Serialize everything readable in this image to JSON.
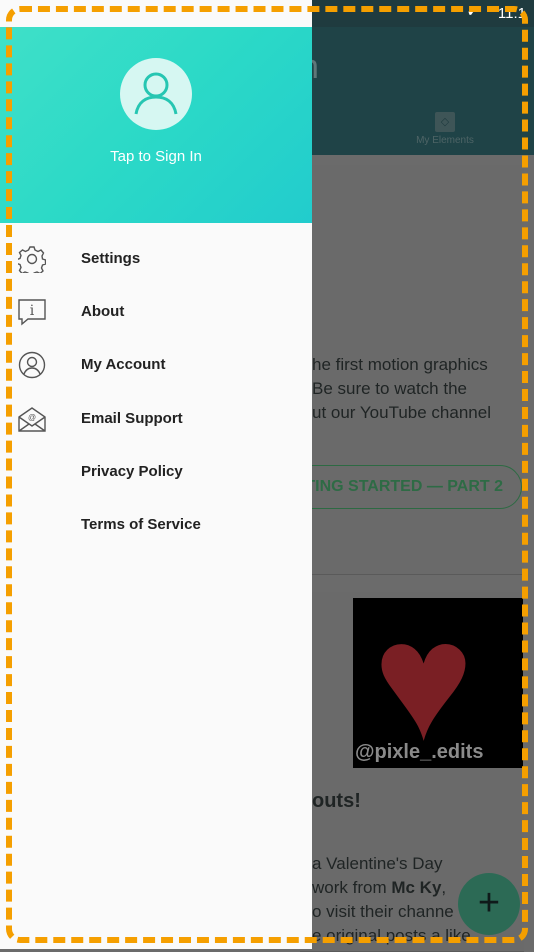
{
  "status_bar": {
    "time": "11:1"
  },
  "background": {
    "logo_fragment": "n",
    "tab_my_elements": "My Elements",
    "card1_text": [
      "he first motion graphics",
      "Be sure to watch the",
      "ut our YouTube channel"
    ],
    "card1_button": "ETTING STARTED — PART 2",
    "card2_image_tag": "@pixle_.edits",
    "card2_title": "outs!",
    "card2_text": [
      "a Valentine's Day",
      "work from ",
      "o visit their channe",
      "e original posts a like"
    ],
    "card2_author": "Mc Ky",
    "fab_label": "+"
  },
  "drawer": {
    "sign_in": "Tap to Sign In",
    "items": [
      {
        "label": "Settings",
        "icon": "gear-icon"
      },
      {
        "label": "About",
        "icon": "info-bubble-icon"
      },
      {
        "label": "My Account",
        "icon": "account-icon"
      },
      {
        "label": "Email Support",
        "icon": "email-icon"
      },
      {
        "label": "Privacy Policy",
        "icon": ""
      },
      {
        "label": "Terms of Service",
        "icon": ""
      }
    ]
  },
  "colors": {
    "accent": "#2bd9c7",
    "overlay_frame": "#f59f00"
  }
}
